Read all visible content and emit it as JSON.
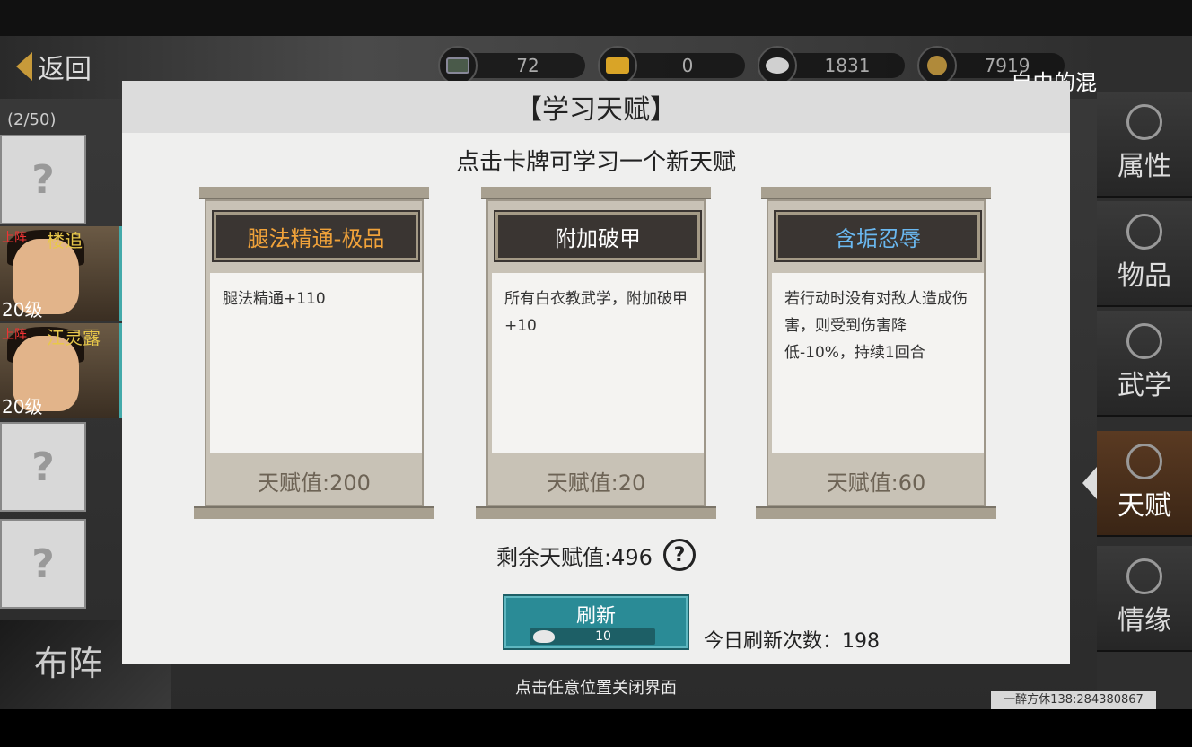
{
  "header": {
    "back_label": "返回",
    "resources": [
      {
        "icon": "cart-icon",
        "value": "72",
        "color": "#4a5a4a"
      },
      {
        "icon": "gold-bar-icon",
        "value": "0",
        "color": "#d9a427"
      },
      {
        "icon": "silver-ingot-icon",
        "value": "1831",
        "color": "#d0d0d0"
      },
      {
        "icon": "coin-icon",
        "value": "7919",
        "color": "#b08a3a"
      }
    ],
    "top_right_text": "自由的混沌通关"
  },
  "roster": {
    "count_label": "(2/50)",
    "empty_slot_symbol": "?",
    "heroes": [
      {
        "tag": "上阵",
        "name": "楼追",
        "level": "20级"
      },
      {
        "tag": "上阵",
        "name": "江灵露",
        "level": "20级"
      }
    ],
    "formation_label": "布阵"
  },
  "side_menu": {
    "items": [
      {
        "label": "属性",
        "icon": "attribute-icon"
      },
      {
        "label": "物品",
        "icon": "item-box-icon"
      },
      {
        "label": "武学",
        "icon": "book-icon"
      },
      {
        "label": "天赋",
        "icon": "talent-tree-icon",
        "active": true
      },
      {
        "label": "情缘",
        "icon": "heart-icon"
      }
    ]
  },
  "modal": {
    "title": "【学习天赋】",
    "subtitle": "点击卡牌可学习一个新天赋",
    "cards": [
      {
        "name": "腿法精通-极品",
        "name_color": "#f0a23a",
        "description": "腿法精通+110",
        "cost": "天赋值:200"
      },
      {
        "name": "附加破甲",
        "name_color": "#ffffff",
        "description": "所有白衣教武学，附加破甲+10",
        "cost": "天赋值:20"
      },
      {
        "name": "含垢忍辱",
        "name_color": "#6ab8f0",
        "description": "若行动时没有对敌人造成伤害，则受到伤害降低-10%，持续1回合",
        "cost": "天赋值:60"
      }
    ],
    "remaining_label": "剩余天赋值:496",
    "help_symbol": "?",
    "refresh": {
      "label": "刷新",
      "cost": "10"
    },
    "refresh_count_label": "今日刷新次数：198"
  },
  "footer": {
    "close_hint": "点击任意位置关闭界面",
    "player_id": "一醉方休138:284380867"
  }
}
